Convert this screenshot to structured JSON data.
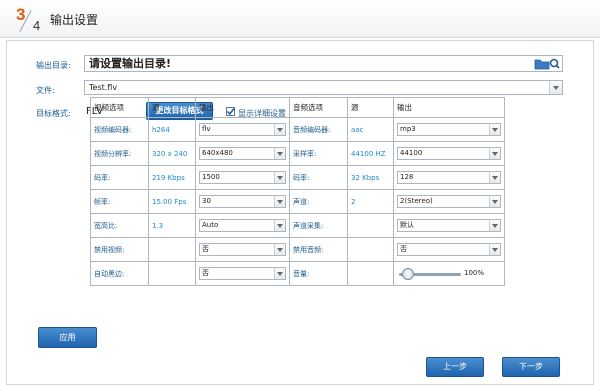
{
  "header": {
    "step_num": "3",
    "step_den": "4",
    "title": "输出设置"
  },
  "form": {
    "output_dir": {
      "label": "输出目录:",
      "value": "请设置输出目录!"
    },
    "file": {
      "label": "文件:",
      "value": "Test.flv"
    },
    "target_format": {
      "label": "目标格式:",
      "value": "FLV",
      "change_button": "更改目标格式",
      "detail_label": "显示详细设置",
      "detail_checked": true
    }
  },
  "table": {
    "video_header": [
      "视频选项",
      "源",
      "输出"
    ],
    "audio_header": [
      "音频选项",
      "源",
      "输出"
    ],
    "rows": [
      {
        "vlabel": "视频编码器:",
        "vsrc": "h264",
        "vout": "flv",
        "alabel": "音频编码器:",
        "asrc": "aac",
        "aout": "mp3"
      },
      {
        "vlabel": "视频分辨率:",
        "vsrc": "320 x 240",
        "vout": "640x480",
        "alabel": "采样率:",
        "asrc": "44100 HZ",
        "aout": "44100"
      },
      {
        "vlabel": "码率:",
        "vsrc": "219 Kbps",
        "vout": "1500",
        "alabel": "码率:",
        "asrc": "32 Kbps",
        "aout": "128"
      },
      {
        "vlabel": "帧率:",
        "vsrc": "15.00 Fps",
        "vout": "30",
        "alabel": "声道:",
        "asrc": "2",
        "aout": "2(Stereo)"
      },
      {
        "vlabel": "宽高比:",
        "vsrc": "1.3",
        "vout": "Auto",
        "alabel": "声道采集:",
        "asrc": "",
        "aout": "默认"
      },
      {
        "vlabel": "禁用视频:",
        "vsrc": "",
        "vout": "否",
        "alabel": "禁用音频:",
        "asrc": "",
        "aout": "否"
      },
      {
        "vlabel": "自动黑边:",
        "vsrc": "",
        "vout": "否",
        "alabel": "音量:",
        "asrc": "",
        "aout": ""
      }
    ],
    "volume": {
      "value": 0.1,
      "text": "100%"
    }
  },
  "buttons": {
    "apply": "应用",
    "prev": "上一步",
    "next": "下一步"
  }
}
